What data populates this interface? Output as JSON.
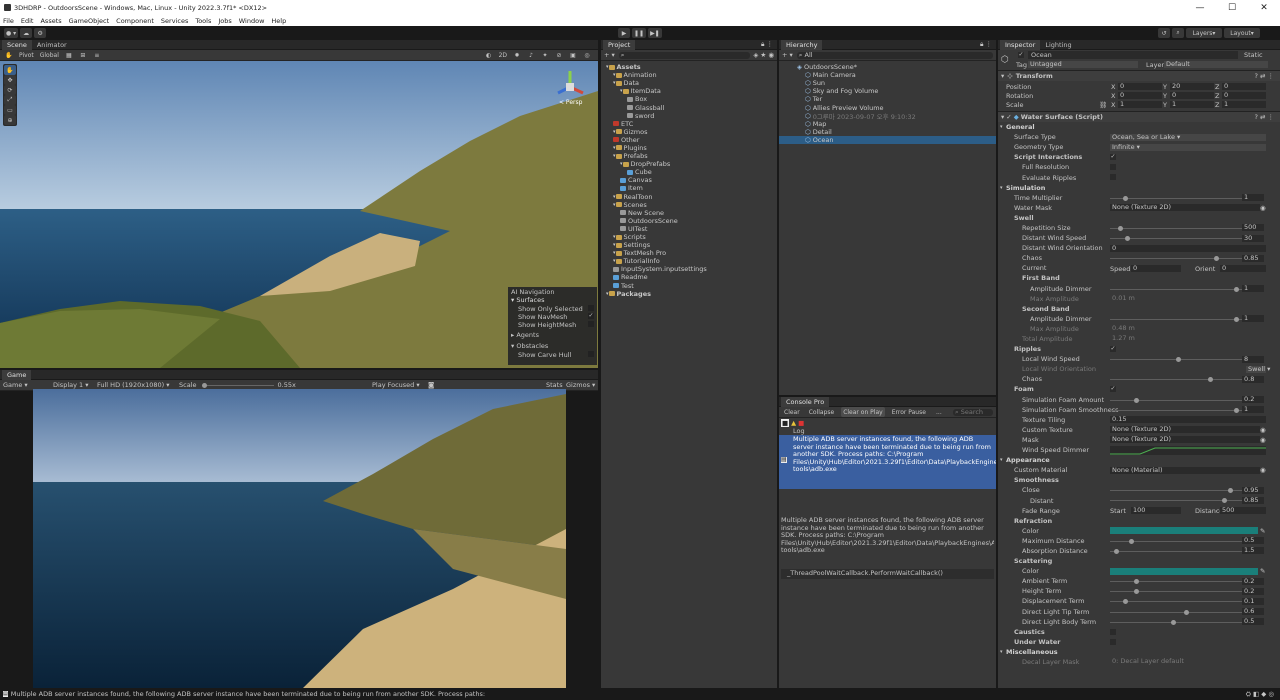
{
  "window": {
    "title": "3DHDRP - OutdoorsScene - Windows, Mac, Linux - Unity 2022.3.7f1* <DX12>",
    "min": "—",
    "max": "☐",
    "close": "✕"
  },
  "menu": [
    "File",
    "Edit",
    "Assets",
    "GameObject",
    "Component",
    "Services",
    "Tools",
    "Jobs",
    "Window",
    "Help"
  ],
  "toolbar": {
    "layers": "Layers",
    "layout": "Layout"
  },
  "scene": {
    "tabs": [
      "Scene",
      "Animator"
    ],
    "pivot": "Pivot",
    "global": "Global",
    "mode2d": "2D",
    "persp": "< Persp",
    "ai_nav": {
      "title": "AI Navigation",
      "surfaces": "Surfaces",
      "show_only_selected": "Show Only Selected",
      "show_navmesh": "Show NavMesh",
      "show_heightmesh": "Show HeightMesh",
      "agents": "Agents",
      "obstacles": "Obstacles",
      "show_carve_hull": "Show Carve Hull"
    }
  },
  "game": {
    "tab": "Game",
    "sub": "Game",
    "display": "Display 1",
    "res": "Full HD (1920x1080)",
    "scale_label": "Scale",
    "scale_val": "0.55x",
    "play_focused": "Play Focused",
    "stats": "Stats",
    "gizmos": "Gizmos"
  },
  "project": {
    "tab": "Project",
    "items": [
      {
        "d": 0,
        "t": "Assets",
        "i": "f",
        "b": true
      },
      {
        "d": 1,
        "t": "Animation",
        "i": "f"
      },
      {
        "d": 1,
        "t": "Data",
        "i": "f"
      },
      {
        "d": 2,
        "t": "ItemData",
        "i": "f"
      },
      {
        "d": 3,
        "t": "Box",
        "i": "cube"
      },
      {
        "d": 3,
        "t": "Glassball",
        "i": "cube"
      },
      {
        "d": 3,
        "t": "sword",
        "i": "cube"
      },
      {
        "d": 1,
        "t": "ETC",
        "i": "r"
      },
      {
        "d": 1,
        "t": "Gizmos",
        "i": "f"
      },
      {
        "d": 1,
        "t": "Other",
        "i": "r"
      },
      {
        "d": 1,
        "t": "Plugins",
        "i": "f"
      },
      {
        "d": 1,
        "t": "Prefabs",
        "i": "f"
      },
      {
        "d": 2,
        "t": "DropPrefabs",
        "i": "f"
      },
      {
        "d": 3,
        "t": "Cube",
        "i": "b"
      },
      {
        "d": 2,
        "t": "Canvas",
        "i": "b"
      },
      {
        "d": 2,
        "t": "Item",
        "i": "b"
      },
      {
        "d": 1,
        "t": "RealToon",
        "i": "f"
      },
      {
        "d": 1,
        "t": "Scenes",
        "i": "f"
      },
      {
        "d": 2,
        "t": "New Scene",
        "i": "cube"
      },
      {
        "d": 2,
        "t": "OutdoorsScene",
        "i": "cube"
      },
      {
        "d": 2,
        "t": "UITest",
        "i": "cube"
      },
      {
        "d": 1,
        "t": "Scripts",
        "i": "f"
      },
      {
        "d": 1,
        "t": "Settings",
        "i": "f"
      },
      {
        "d": 1,
        "t": "TextMesh Pro",
        "i": "f"
      },
      {
        "d": 1,
        "t": "TutorialInfo",
        "i": "f"
      },
      {
        "d": 1,
        "t": "InputSystem.inputsettings",
        "i": "cube"
      },
      {
        "d": 1,
        "t": "Readme",
        "i": "b"
      },
      {
        "d": 1,
        "t": "Test",
        "i": "b"
      },
      {
        "d": 0,
        "t": "Packages",
        "i": "f",
        "b": true
      }
    ]
  },
  "hierarchy": {
    "tab": "Hierarchy",
    "search_ph": "All",
    "items": [
      {
        "d": 0,
        "t": "OutdoorsScene*"
      },
      {
        "d": 1,
        "t": "Main Camera"
      },
      {
        "d": 1,
        "t": "Sun"
      },
      {
        "d": 1,
        "t": "Sky and Fog Volume"
      },
      {
        "d": 1,
        "t": "Ter"
      },
      {
        "d": 1,
        "t": "Allies Preview Volume"
      },
      {
        "d": 1,
        "t": "0그루마 2023-09-07 오후 9:10:32",
        "dim": true
      },
      {
        "d": 1,
        "t": "Map"
      },
      {
        "d": 1,
        "t": "Detail"
      },
      {
        "d": 1,
        "t": "Ocean",
        "sel": true
      }
    ]
  },
  "console": {
    "tab": "Console Pro",
    "btns": [
      "Clear",
      "Collapse",
      "Clear on Play",
      "Error Pause",
      "..."
    ],
    "search_ph": "Search",
    "log_label": "Log",
    "entry": "Multiple ADB server instances found, the following ADB server instance have been terminated due to being run from another SDK. Process paths: C:\\Program Files\\Unity\\Hub\\Editor\\2021.3.29f1\\Editor\\Data\\PlaybackEngines\\AndroidPlayer\\SDK\\platform-tools\\adb.exe",
    "detail": "Multiple ADB server instances found, the following ADB server instance have been terminated due to being run from another SDK. Process paths: C:\\Program Files\\Unity\\Hub\\Editor\\2021.3.29f1\\Editor\\Data\\PlaybackEngines\\AndroidPlayer\\SDK\\platform-tools\\adb.exe",
    "stack": "_ThreadPoolWaitCallback.PerformWaitCallback()"
  },
  "inspector": {
    "tabs": [
      "Inspector",
      "Lighting"
    ],
    "name": "Ocean",
    "static": "Static",
    "tag_label": "Tag",
    "tag": "Untagged",
    "layer_label": "Layer",
    "layer": "Default",
    "transform": "Transform",
    "position": "Position",
    "rotation": "Rotation",
    "scale": "Scale",
    "pos": [
      "0",
      "20",
      "0"
    ],
    "rot": [
      "0",
      "0",
      "0"
    ],
    "scl": [
      "1",
      "1",
      "1"
    ],
    "component": "Water Surface (Script)",
    "rows": [
      {
        "k": "hdr",
        "l": "General"
      },
      {
        "k": "dd",
        "l": "Surface Type",
        "v": "Ocean, Sea or Lake"
      },
      {
        "k": "dd",
        "l": "Geometry Type",
        "v": "Infinite"
      },
      {
        "k": "chk",
        "l": "Script Interactions",
        "v": "✓",
        "bold": true
      },
      {
        "k": "chk",
        "l": "Full Resolution",
        "ind": 1
      },
      {
        "k": "chk",
        "l": "Evaluate Ripples",
        "ind": 1
      },
      {
        "k": "hdr",
        "l": "Simulation"
      },
      {
        "k": "sl",
        "l": "Time Multiplier",
        "v": "1",
        "p": 0.1
      },
      {
        "k": "obj",
        "l": "Water Mask",
        "v": "None (Texture 2D)"
      },
      {
        "k": "sub",
        "l": "Swell"
      },
      {
        "k": "sl",
        "l": "Repetition Size",
        "v": "500",
        "p": 0.06,
        "ind": 1
      },
      {
        "k": "sl",
        "l": "Distant Wind Speed",
        "v": "30",
        "p": 0.12,
        "ind": 1
      },
      {
        "k": "txt",
        "l": "Distant Wind Orientation",
        "v": "0",
        "ind": 1
      },
      {
        "k": "sl",
        "l": "Chaos",
        "v": "0.85",
        "p": 0.82,
        "ind": 1
      },
      {
        "k": "two",
        "l": "Current",
        "a": "Speed",
        "av": "0",
        "b": "Orient",
        "bv": "0",
        "ind": 1
      },
      {
        "k": "sub",
        "l": "First Band",
        "ind": 1
      },
      {
        "k": "sl",
        "l": "Amplitude Dimmer",
        "v": "1",
        "p": 0.98,
        "ind": 2
      },
      {
        "k": "txt",
        "l": "Max Amplitude",
        "v": "0.01 m",
        "ind": 2,
        "dim": true
      },
      {
        "k": "sub",
        "l": "Second Band",
        "ind": 1
      },
      {
        "k": "sl",
        "l": "Amplitude Dimmer",
        "v": "1",
        "p": 0.98,
        "ind": 2
      },
      {
        "k": "txt",
        "l": "Max Amplitude",
        "v": "0.48 m",
        "ind": 2,
        "dim": true
      },
      {
        "k": "txt",
        "l": "Total Amplitude",
        "v": "1.27 m",
        "ind": 1,
        "dim": true
      },
      {
        "k": "chk",
        "l": "Ripples",
        "v": "✓",
        "bold": true
      },
      {
        "k": "sl",
        "l": "Local Wind Speed",
        "v": "8",
        "p": 0.52,
        "ind": 1
      },
      {
        "k": "dd",
        "l": "Local Wind Orientation",
        "v": "Swell",
        "ind": 1,
        "dim": true,
        "short": true
      },
      {
        "k": "sl",
        "l": "Chaos",
        "v": "0.8",
        "p": 0.77,
        "ind": 1
      },
      {
        "k": "chk",
        "l": "Foam",
        "v": "✓",
        "bold": true
      },
      {
        "k": "sl",
        "l": "Simulation Foam Amount",
        "v": "0.2",
        "p": 0.19,
        "ind": 1
      },
      {
        "k": "sl",
        "l": "Simulation Foam Smoothness",
        "v": "1",
        "p": 0.98,
        "ind": 1
      },
      {
        "k": "txt",
        "l": "Texture Tiling",
        "v": "0.15",
        "ind": 1
      },
      {
        "k": "obj",
        "l": "Custom Texture",
        "v": "None (Texture 2D)",
        "ind": 1
      },
      {
        "k": "obj",
        "l": "Mask",
        "v": "None (Texture 2D)",
        "ind": 1
      },
      {
        "k": "curve",
        "l": "Wind Speed Dimmer",
        "ind": 1
      },
      {
        "k": "hdr",
        "l": "Appearance"
      },
      {
        "k": "obj",
        "l": "Custom Material",
        "v": "None (Material)"
      },
      {
        "k": "sub",
        "l": "Smoothness"
      },
      {
        "k": "sl",
        "l": "Close",
        "v": "0.95",
        "p": 0.93,
        "ind": 1
      },
      {
        "k": "sl",
        "l": "Distant",
        "v": "0.85",
        "p": 0.88,
        "ind": 2
      },
      {
        "k": "two",
        "l": "Fade Range",
        "a": "Start",
        "av": "100",
        "b": "Distance",
        "bv": "500",
        "ind": 1
      },
      {
        "k": "sub",
        "l": "Refraction"
      },
      {
        "k": "color",
        "l": "Color",
        "ind": 1
      },
      {
        "k": "sl",
        "l": "Maximum Distance",
        "v": "0.5",
        "p": 0.15,
        "ind": 1
      },
      {
        "k": "sl",
        "l": "Absorption Distance",
        "v": "1.5",
        "p": 0.03,
        "ind": 1
      },
      {
        "k": "sub",
        "l": "Scattering"
      },
      {
        "k": "color",
        "l": "Color",
        "ind": 1
      },
      {
        "k": "sl",
        "l": "Ambient Term",
        "v": "0.2",
        "p": 0.19,
        "ind": 1
      },
      {
        "k": "sl",
        "l": "Height Term",
        "v": "0.2",
        "p": 0.19,
        "ind": 1
      },
      {
        "k": "sl",
        "l": "Displacement Term",
        "v": "0.1",
        "p": 0.1,
        "ind": 1
      },
      {
        "k": "sl",
        "l": "Direct Light Tip Term",
        "v": "0.6",
        "p": 0.58,
        "ind": 1
      },
      {
        "k": "sl",
        "l": "Direct Light Body Term",
        "v": "0.5",
        "p": 0.48,
        "ind": 1
      },
      {
        "k": "chk",
        "l": "Caustics",
        "bold": true
      },
      {
        "k": "chk",
        "l": "Under Water",
        "bold": true
      },
      {
        "k": "hdr",
        "l": "Miscellaneous"
      },
      {
        "k": "txt",
        "l": "Decal Layer Mask",
        "v": "0: Decal Layer default",
        "ind": 1,
        "dim": true
      }
    ]
  },
  "status": "Multiple ADB server instances found, the following ADB server instance have been terminated due to being run from another SDK. Process paths:",
  "colors": {
    "water": "#1a7f7a",
    "selected": "#2c5d87",
    "console_sel": "#3a5fa0"
  }
}
